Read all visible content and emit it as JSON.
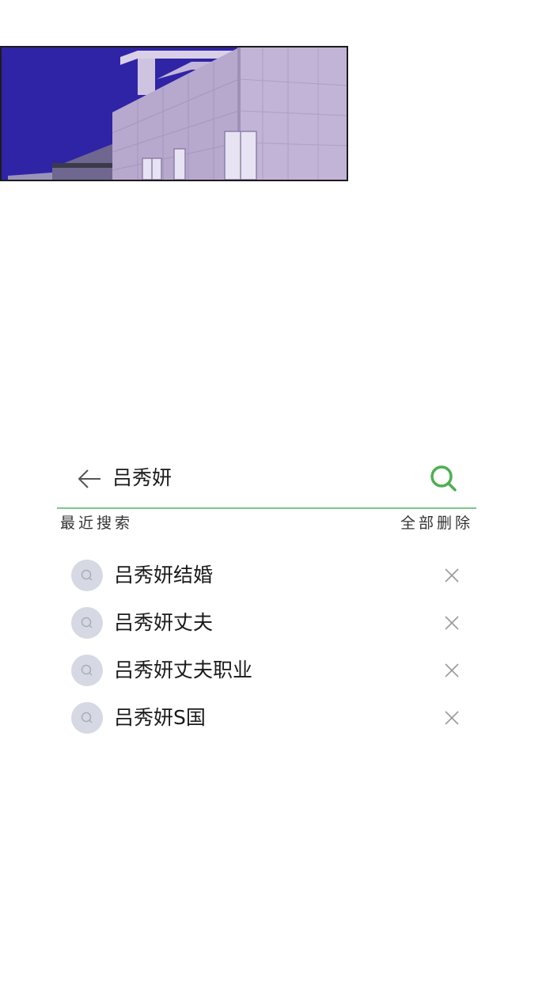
{
  "search": {
    "query": "吕秀妍"
  },
  "recent": {
    "title": "最近搜索",
    "clear_all_label": "全部删除",
    "items": [
      {
        "label": "吕秀妍结婚"
      },
      {
        "label": "吕秀妍丈夫"
      },
      {
        "label": "吕秀妍丈夫职业"
      },
      {
        "label": "吕秀妍S国"
      }
    ]
  },
  "colors": {
    "accent": "#4caf50",
    "underline": "#7ac98a",
    "history_icon_bg": "#d6d9e3",
    "sky": "#2f24a6",
    "building": "#b9a9cf"
  },
  "icons": [
    "back-arrow-icon",
    "search-icon",
    "history-search-icon",
    "close-icon"
  ]
}
